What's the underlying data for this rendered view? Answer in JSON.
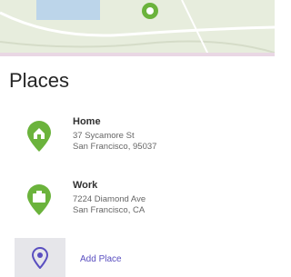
{
  "colors": {
    "accent": "#6bb33c",
    "map_land": "#e7eddd",
    "map_water": "#bcd5ea",
    "add_accent": "#5a4fc0"
  },
  "header": {
    "title": "Places"
  },
  "places": [
    {
      "name": "Home",
      "address": "37 Sycamore St\nSan Francisco, 95037",
      "icon": "home-pin-icon"
    },
    {
      "name": "Work",
      "address": "7224 Diamond Ave\nSan Francisco, CA",
      "icon": "work-pin-icon"
    }
  ],
  "add_place": {
    "label": "Add Place",
    "icon": "add-location-icon"
  }
}
